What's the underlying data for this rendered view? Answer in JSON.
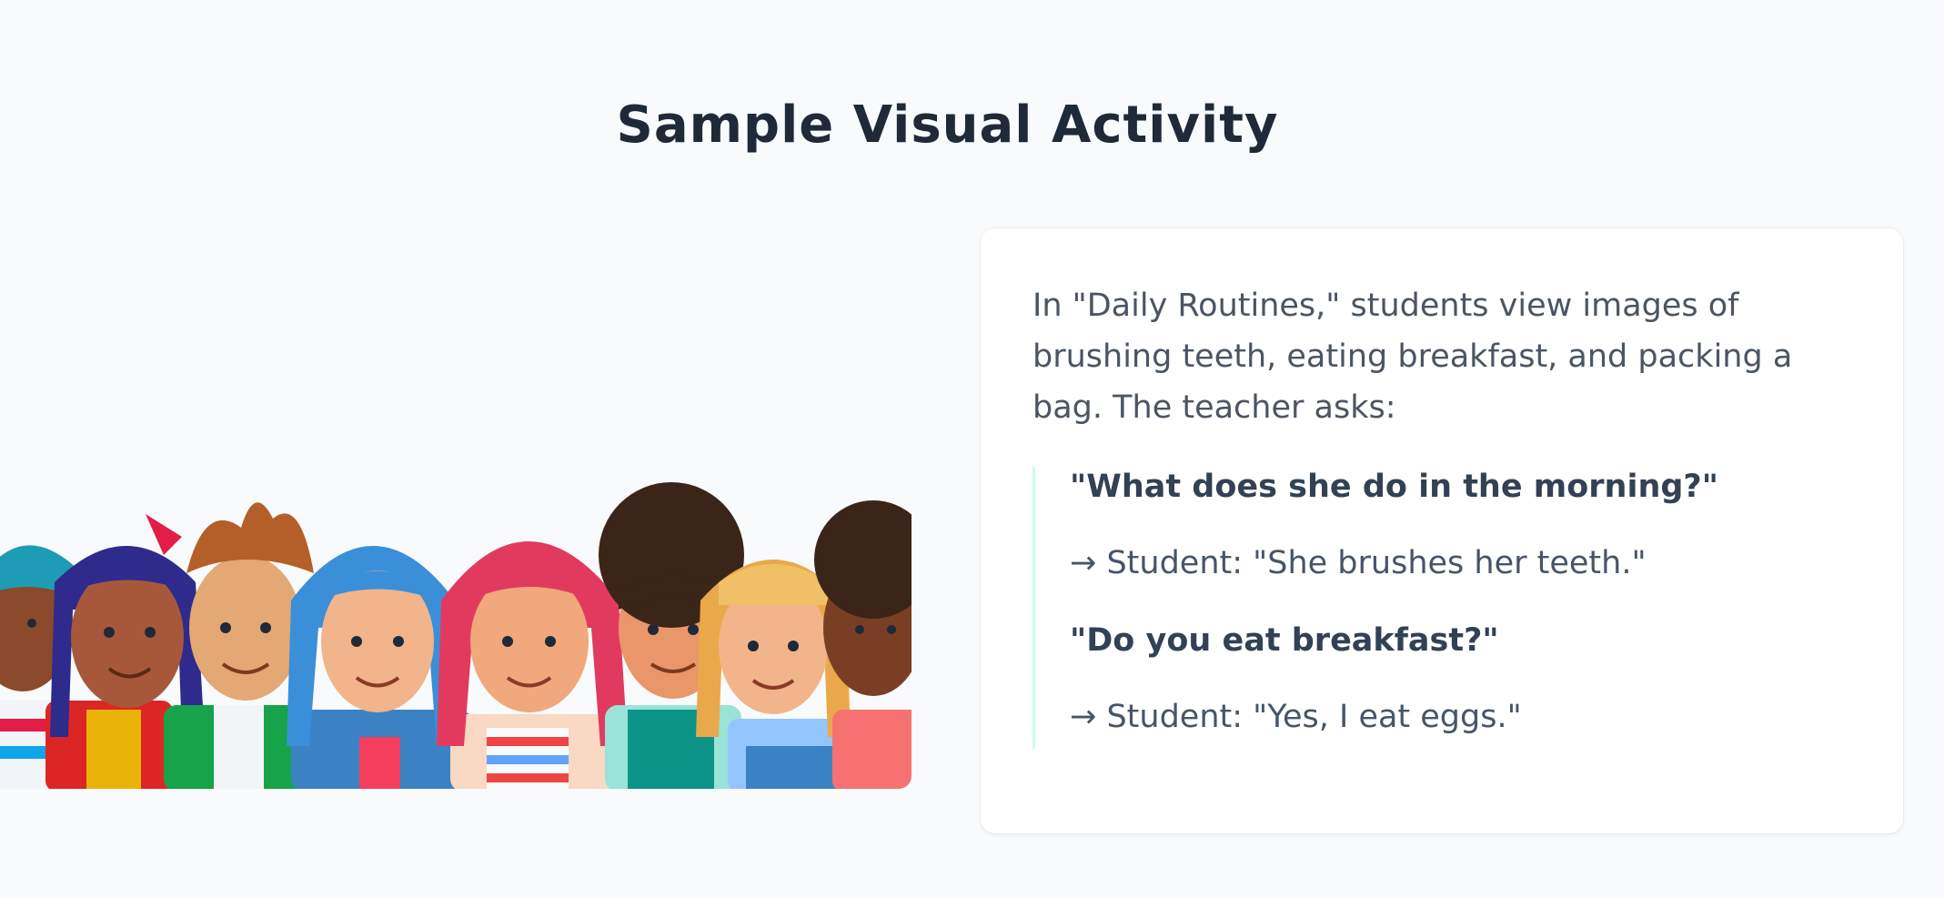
{
  "page": {
    "title": "Sample Visual Activity"
  },
  "illustration": {
    "subject": "group-of-students-illustration"
  },
  "card": {
    "intro": "In \"Daily Routines,\" students view images of brushing teeth, eating breakfast, and packing a bag. The teacher asks:",
    "dialogue": [
      {
        "question": "\"What does she do in the morning?\"",
        "answer": "→ Student: \"She brushes her teeth.\""
      },
      {
        "question": "\"Do you eat breakfast?\"",
        "answer": "→ Student: \"Yes, I eat eggs.\""
      }
    ]
  },
  "colors": {
    "background": "#f8fafc",
    "title": "#1f2937",
    "card": "#ffffff",
    "accent_border": "#ccfbf1",
    "body_text": "#4b5563"
  }
}
